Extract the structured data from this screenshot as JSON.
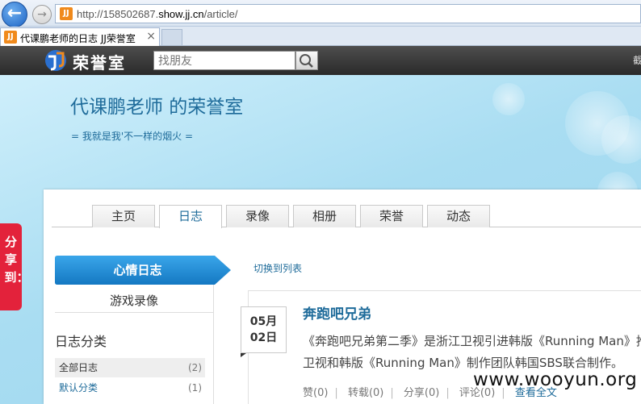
{
  "browser": {
    "url_prefix": "http://158502687.",
    "url_domain": "show.jj.cn",
    "url_suffix": "/article/",
    "tab_title": "代课鹏老师的日志 JJ荣誉室",
    "favicon_label": "JJ",
    "close_glyph": "×"
  },
  "site": {
    "logo_text": "荣誉室",
    "search_placeholder": "找朋友",
    "bar_right": "截"
  },
  "header": {
    "title": "代课鹏老师 的荣誉室",
    "motto": "= 我就是我'不一样的烟火 ="
  },
  "tabs": [
    {
      "label": "主页"
    },
    {
      "label": "日志"
    },
    {
      "label": "录像"
    },
    {
      "label": "相册"
    },
    {
      "label": "荣誉"
    },
    {
      "label": "动态"
    }
  ],
  "sidebar": {
    "active_label": "心情日志",
    "item_label": "游戏录像",
    "category_title": "日志分类",
    "categories": [
      {
        "name": "全部日志",
        "count": "(2)"
      },
      {
        "name": "默认分类",
        "count": "(1)"
      }
    ]
  },
  "main": {
    "switch_link": "切换到列表",
    "article": {
      "month": "05月",
      "day": "02日",
      "title": "奔跑吧兄弟",
      "line1": "《奔跑吧兄弟第二季》是浙江卫视引进韩版《Running Man》推出",
      "line2": "卫视和韩版《Running Man》制作团队韩国SBS联合制作。",
      "actions": {
        "like": "赞(0)",
        "repost": "转载(0)",
        "share": "分享(0)",
        "comment": "评论(0)",
        "more": "查看全文"
      }
    }
  },
  "share_side": "分享到：",
  "watermark": "www.wooyun.org",
  "colors": {
    "accent": "#1e6b9a",
    "active_tab_bg": "#1f8fd8",
    "share_red": "#e3223b"
  }
}
